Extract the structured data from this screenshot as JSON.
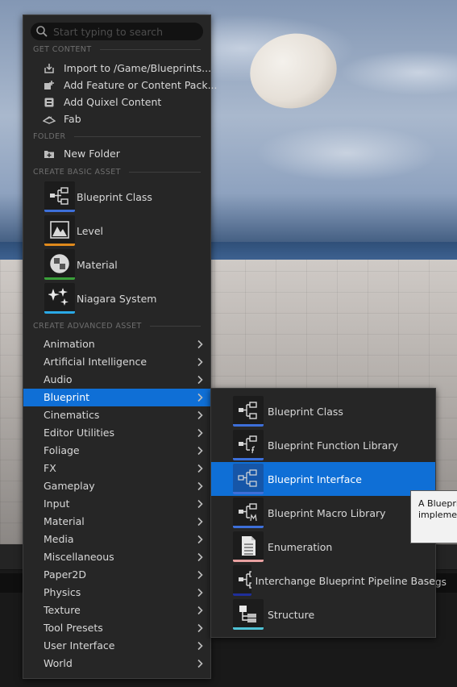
{
  "search": {
    "placeholder": "Start typing to search"
  },
  "sections": {
    "get_content": "GET CONTENT",
    "folder": "FOLDER",
    "create_basic_asset": "CREATE BASIC ASSET",
    "create_advanced_asset": "CREATE ADVANCED ASSET"
  },
  "get_content_items": [
    {
      "label": "Import to /Game/Blueprints...",
      "icon": "import-icon"
    },
    {
      "label": "Add Feature or Content Pack...",
      "icon": "feature-pack-icon"
    },
    {
      "label": "Add Quixel Content",
      "icon": "quixel-icon"
    },
    {
      "label": "Fab",
      "icon": "fab-icon"
    }
  ],
  "folder_items": [
    {
      "label": "New Folder",
      "icon": "new-folder-icon"
    }
  ],
  "basic_assets": [
    {
      "label": "Blueprint Class",
      "icon": "blueprint-class-icon",
      "color": "#3d6fd9"
    },
    {
      "label": "Level",
      "icon": "level-icon",
      "color": "#e08a1c"
    },
    {
      "label": "Material",
      "icon": "material-icon",
      "color": "#3aa03a"
    },
    {
      "label": "Niagara System",
      "icon": "niagara-icon",
      "color": "#2aa9e6"
    }
  ],
  "advanced_categories": [
    "Animation",
    "Artificial Intelligence",
    "Audio",
    "Blueprint",
    "Cinematics",
    "Editor Utilities",
    "Foliage",
    "FX",
    "Gameplay",
    "Input",
    "Material",
    "Media",
    "Miscellaneous",
    "Paper2D",
    "Physics",
    "Texture",
    "Tool Presets",
    "User Interface",
    "World"
  ],
  "active_category": "Blueprint",
  "blueprint_submenu": [
    {
      "label": "Blueprint Class",
      "icon": "blueprint-class-icon",
      "color": "#3d6fd9"
    },
    {
      "label": "Blueprint Function Library",
      "icon": "blueprint-function-library-icon",
      "color": "#3d6fd9"
    },
    {
      "label": "Blueprint Interface",
      "icon": "blueprint-interface-icon",
      "color": "#3d6fd9"
    },
    {
      "label": "Blueprint Macro Library",
      "icon": "blueprint-macro-library-icon",
      "color": "#3d6fd9"
    },
    {
      "label": "Enumeration",
      "icon": "enumeration-icon",
      "color": "#e8a0a0"
    },
    {
      "label": "Interchange Blueprint Pipeline Base",
      "icon": "interchange-pipeline-icon",
      "color": "#1f2f9a"
    },
    {
      "label": "Structure",
      "icon": "structure-icon",
      "color": "#4fc3d6"
    }
  ],
  "active_submenu_item": "Blueprint Interface",
  "tooltip": {
    "line1": "A Bluepri",
    "line2": "implemen"
  },
  "bottom_panel": {
    "settings_fragment": "gs"
  },
  "colors": {
    "accent": "#0f6fd6",
    "menu_bg": "#262626"
  }
}
